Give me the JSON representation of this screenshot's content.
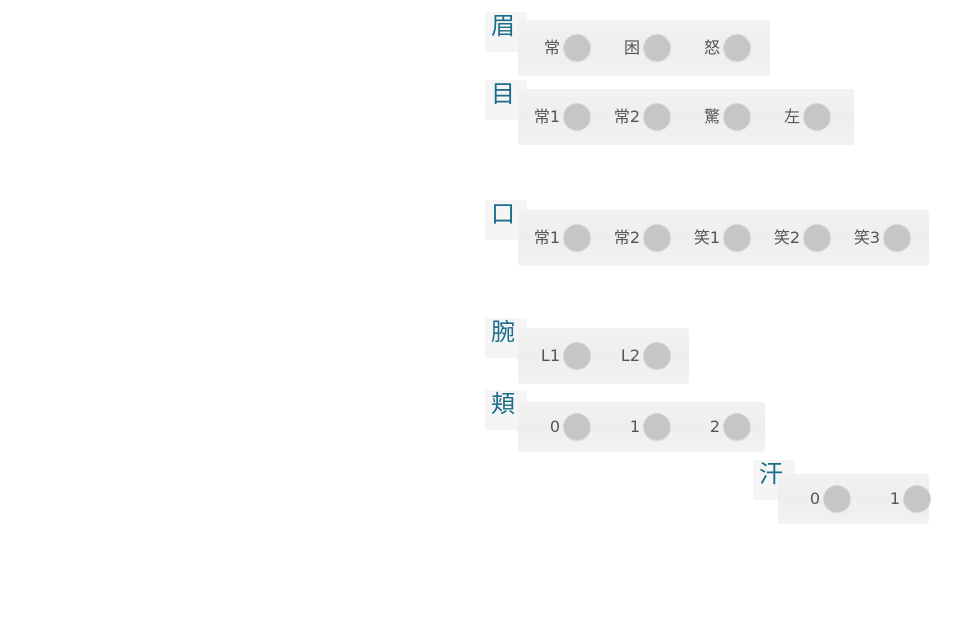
{
  "groups": [
    {
      "category": "眉",
      "options": [
        "常",
        "困",
        "怒"
      ]
    },
    {
      "category": "目",
      "options": [
        "常1",
        "常2",
        "驚",
        "左"
      ]
    },
    {
      "category": "口",
      "options": [
        "常1",
        "常2",
        "笑1",
        "笑2",
        "笑3"
      ]
    },
    {
      "category": "腕",
      "options": [
        "L1",
        "L2"
      ]
    },
    {
      "category": "頬",
      "options": [
        "0",
        "1",
        "2"
      ]
    },
    {
      "category": "汗",
      "options": [
        "0",
        "1"
      ]
    }
  ],
  "colors": {
    "category_text": "#1c6d8a",
    "panel_bg": "#f0f0f0",
    "radio_dot": "#c6c6c6",
    "option_text": "#555555"
  }
}
